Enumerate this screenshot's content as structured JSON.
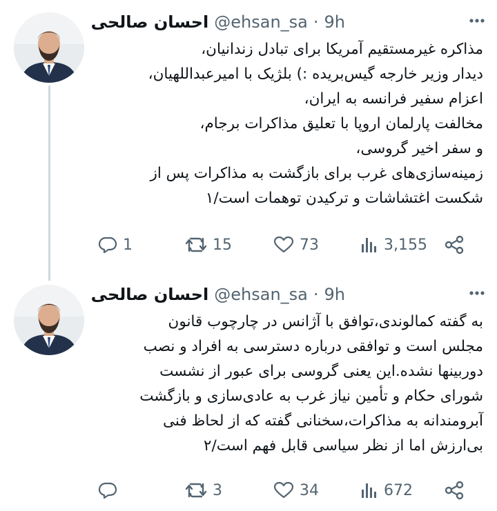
{
  "colors": {
    "text": "#0f1419",
    "secondary": "#536471",
    "thread_line": "#cfd9de",
    "background": "#ffffff"
  },
  "tweets": [
    {
      "author_name": "احسان صالحی",
      "handle": "@ehsan_sa",
      "separator": "·",
      "time": "9h",
      "lines": [
        "مذاکره غیرمستقیم آمریکا برای تبادل زندانیان،",
        "دیدار وزیر خارجه گیس‌بریده :) بلژیک با امیرعبداللهیان،",
        "اعزام سفیر فرانسه به ایران،",
        "مخالفت پارلمان اروپا با تعلیق مذاکرات برجام،",
        "و سفر اخیر گروسی،",
        "زمینه‌سازی‌های غرب برای بازگشت به مذاکرات پس از",
        "شکست اغتشاشات و ترکیدن توهمات است/۱"
      ],
      "reply_count": "1",
      "retweet_count": "15",
      "like_count": "73",
      "view_count": "3,155",
      "icons": {
        "reply": "reply-bubble-icon",
        "retweet": "retweet-icon",
        "like": "heart-icon",
        "views": "views-bar-chart-icon",
        "share": "share-icon",
        "more": "more-dots-icon"
      }
    },
    {
      "author_name": "احسان صالحی",
      "handle": "@ehsan_sa",
      "separator": "·",
      "time": "9h",
      "lines": [
        "به گفته کمالوندی،توافق با آژانس در چارچوب قانون",
        "مجلس است و توافقی درباره دسترسی به افراد و نصب",
        "دوربینها نشده.این یعنی گروسی برای عبور از نشست",
        "شورای حکام و تأمین نیاز غرب به عادی‌سازی و بازگشت",
        "آبرومندانه به مذاکرات،سخنانی گفته که از لحاظ فنی",
        "بی‌ارزش اما از نظر سیاسی قابل فهم است/۲"
      ],
      "reply_count": "",
      "retweet_count": "3",
      "like_count": "34",
      "view_count": "672",
      "icons": {
        "reply": "reply-bubble-icon",
        "retweet": "retweet-icon",
        "like": "heart-icon",
        "views": "views-bar-chart-icon",
        "share": "share-icon",
        "more": "more-dots-icon"
      }
    }
  ]
}
